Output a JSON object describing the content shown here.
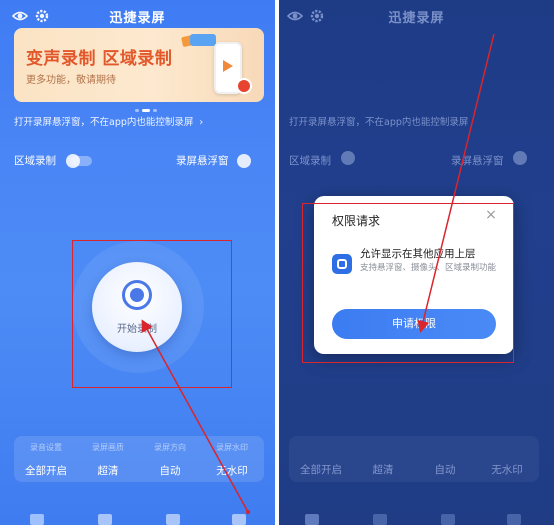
{
  "left": {
    "app_title": "迅捷录屏",
    "icons": {
      "eye": "eye-icon",
      "settings": "gear-icon"
    },
    "banner": {
      "title": "变声录制 区域录制",
      "subtitle": "更多功能，敬请期待"
    },
    "notice": "打开录屏悬浮窗，不在app内也能控制录屏",
    "notice_chevron": "›",
    "options": {
      "region_record": "区域录制",
      "floating_window": "录屏悬浮窗"
    },
    "record_button_label": "开始录制",
    "status": [
      {
        "caption": "录音设置",
        "value": "全部开启"
      },
      {
        "caption": "录屏画质",
        "value": "超清"
      },
      {
        "caption": "录屏方向",
        "value": "自动"
      },
      {
        "caption": "录屏水印",
        "value": "无水印"
      }
    ]
  },
  "right": {
    "app_title": "迅捷录屏",
    "notice": "打开录屏悬浮窗，不在app内也能控制录屏",
    "options": {
      "region_record": "区域录制",
      "floating_window": "录屏悬浮窗"
    },
    "status": [
      {
        "value": "全部开启"
      },
      {
        "value": "超清"
      },
      {
        "value": "自动"
      },
      {
        "value": "无水印"
      }
    ],
    "dialog": {
      "title": "权限请求",
      "close": "×",
      "permission_title": "允许显示在其他应用上层",
      "permission_desc": "支持悬浮窗、摄像头、区域录制功能",
      "apply_button": "申请权限"
    }
  },
  "colors": {
    "primary_blue": "#4a86f5",
    "dim_overlay": "#1f3c85",
    "banner_title": "#e2582a",
    "annotation_red": "#d9252b",
    "button_blue": "#3c7cf2"
  }
}
